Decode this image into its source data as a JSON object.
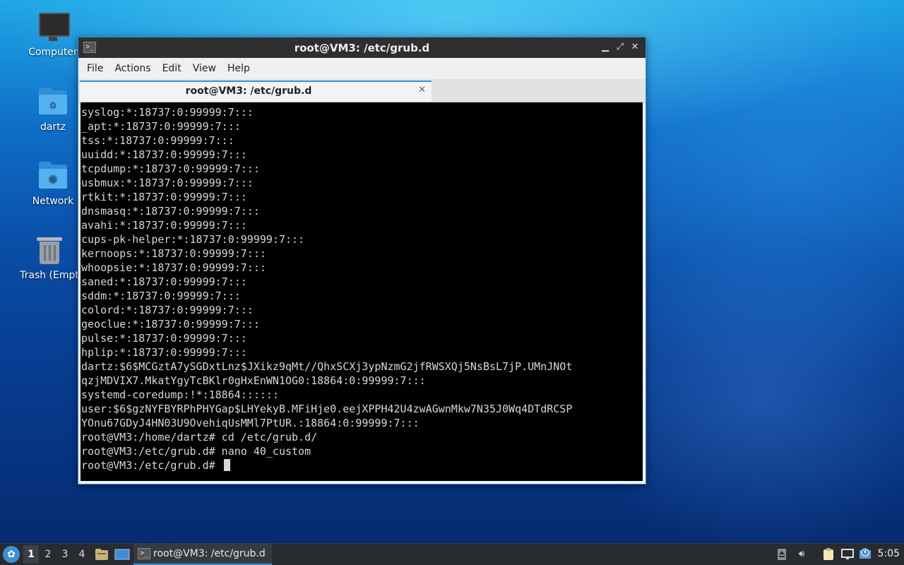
{
  "desktop": {
    "icons": [
      {
        "label": "Computer"
      },
      {
        "label": "dartz"
      },
      {
        "label": "Network"
      },
      {
        "label": "Trash (Empt"
      }
    ]
  },
  "window": {
    "title": "root@VM3: /etc/grub.d",
    "menu": [
      "File",
      "Actions",
      "Edit",
      "View",
      "Help"
    ],
    "tab": {
      "label": "root@VM3: /etc/grub.d"
    }
  },
  "terminal": {
    "lines": [
      "syslog:*:18737:0:99999:7:::",
      "_apt:*:18737:0:99999:7:::",
      "tss:*:18737:0:99999:7:::",
      "uuidd:*:18737:0:99999:7:::",
      "tcpdump:*:18737:0:99999:7:::",
      "usbmux:*:18737:0:99999:7:::",
      "rtkit:*:18737:0:99999:7:::",
      "dnsmasq:*:18737:0:99999:7:::",
      "avahi:*:18737:0:99999:7:::",
      "cups-pk-helper:*:18737:0:99999:7:::",
      "kernoops:*:18737:0:99999:7:::",
      "whoopsie:*:18737:0:99999:7:::",
      "saned:*:18737:0:99999:7:::",
      "sddm:*:18737:0:99999:7:::",
      "colord:*:18737:0:99999:7:::",
      "geoclue:*:18737:0:99999:7:::",
      "pulse:*:18737:0:99999:7:::",
      "hplip:*:18737:0:99999:7:::",
      "dartz:$6$MCGztA7ySGDxtLnz$JXikz9qMt//QhxSCXj3ypNzmG2jfRWSXQj5NsBsL7jP.UMnJNOt",
      "qzjMDVIX7.MkatYgyTcBKlr0gHxEnWN1OG0:18864:0:99999:7:::",
      "systemd-coredump:!*:18864::::::",
      "user:$6$gzNYFBYRPhPHYGap$LHYekyB.MFiHje0.eejXPPH42U4zwAGwnMkw7N35J0Wq4DTdRCSP",
      "YOnu67GDyJ4HN03U9OvehiqUsMMl7PtUR.:18864:0:99999:7:::",
      "root@VM3:/home/dartz# cd /etc/grub.d/",
      "root@VM3:/etc/grub.d# nano 40_custom"
    ],
    "prompt": "root@VM3:/etc/grub.d# "
  },
  "taskbar": {
    "workspaces": [
      "1",
      "2",
      "3",
      "4"
    ],
    "active_workspace": "1",
    "task_label": "root@VM3: /etc/grub.d",
    "clock": "5:05"
  }
}
